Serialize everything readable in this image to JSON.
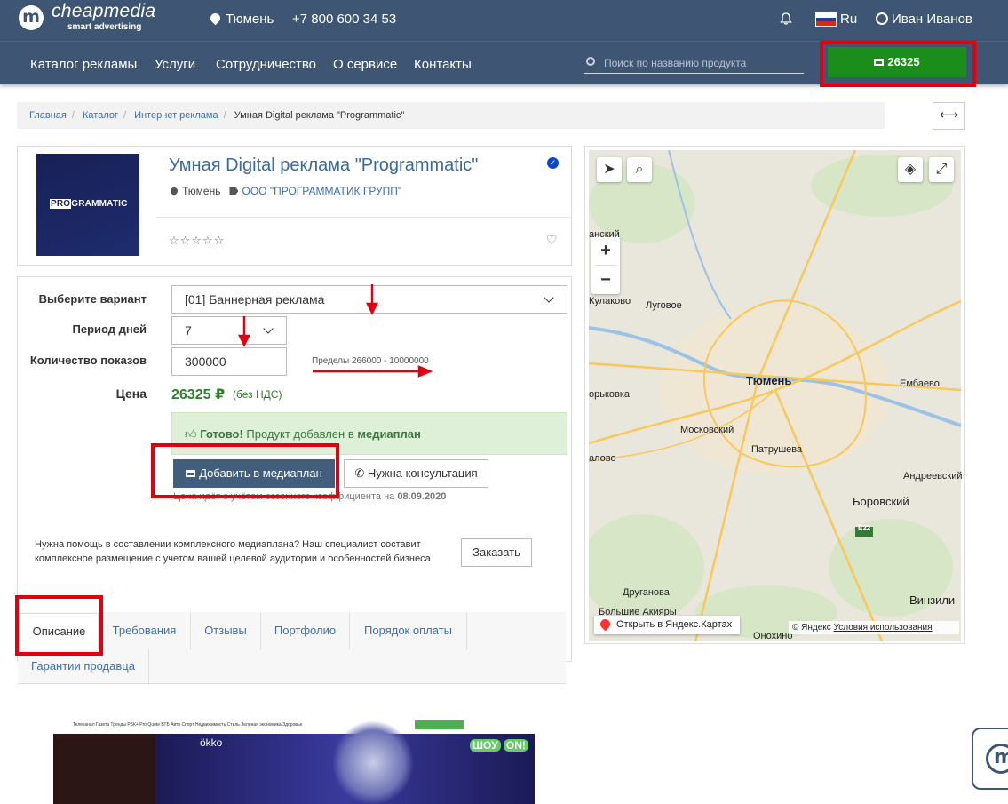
{
  "header": {
    "logo_mark": "m",
    "logo_name": "cheapmedia",
    "logo_sub": "smart advertising",
    "city": "Тюмень",
    "phone": "+7 800 600 34 53",
    "lang": "Ru",
    "user": "Иван Иванов"
  },
  "nav": {
    "items": [
      "Каталог рекламы",
      "Услуги",
      "Сотрудничество",
      "О сервисе",
      "Контакты"
    ],
    "search_placeholder": "Поиск по названию продукта",
    "cart_total": "26325"
  },
  "breadcrumb": {
    "items": [
      "Главная",
      "Каталог",
      "Интернет реклама"
    ],
    "current": "Умная Digital реклама \"Programmatic\""
  },
  "product": {
    "image_text_pro": "PRO",
    "image_text_rest": "GRAMMATIC",
    "title": "Умная Digital реклама \"Programmatic\"",
    "city": "Тюмень",
    "company": "ООО \"ПРОГРАММАТИК ГРУПП\"",
    "rating": 0,
    "stars": "☆☆☆☆☆",
    "heart": "♡"
  },
  "form": {
    "variant_label": "Выберите вариант",
    "variant_value": "[01] Баннерная реклама",
    "period_label": "Период дней",
    "period_value": "7",
    "shows_label": "Количество показов",
    "shows_value": "300000",
    "limits": "Пределы 266000 - 10000000",
    "price_label": "Цена",
    "price_value": "26325 ₽",
    "price_note": "(без НДС)",
    "alert_bold": "Готово!",
    "alert_text": " Продукт добавлен в ",
    "alert_link": "медиаплан",
    "add_button": "Добавить в медиаплан",
    "consult_button": "Нужна консультация",
    "season_note": "Цена идёт с учётом сезонного коэффициента на ",
    "season_date": "08.09.2020",
    "help_text": "Нужна помощь в составлении комплексного медиаплана? Наш специалист составит комплексное размещение с учетом вашей целевой аудитории и особенностей бизнеса",
    "order_button": "Заказать"
  },
  "tabs": [
    "Описание",
    "Требования",
    "Отзывы",
    "Портфолио",
    "Порядок оплаты",
    "Гарантии продавца"
  ],
  "preview": {
    "nav_text": "Телеканал   Газета   Тренды   РБК+   Pro   Quote   ВТБ   Авто   Спорт   Недвижимость   Стиль   Зеленая экономика   Здоровье",
    "brand": "ökko",
    "show": "ШОУ",
    "show_badge": "ON!"
  },
  "map": {
    "city": "Тюмень",
    "labels": [
      "Кулаково",
      "Луговое",
      "Московский",
      "Патрушева",
      "Боровский",
      "Андреевский",
      "Винзили",
      "Друганова",
      "Большие Акияры",
      "Онохино",
      "Ембаево",
      "орьковка",
      "алово",
      "анский"
    ],
    "road_label": "E22",
    "open_link": "Открыть в Яндекс.Картах",
    "copyright": "© Яндекс",
    "terms": "Условия использования"
  },
  "colors": {
    "header_bg": "#3e5673",
    "cart_green": "#1a8d1a",
    "link_blue": "#3b6fb4",
    "price_green": "#2c7d2c",
    "annotation_red": "#e0000f"
  }
}
